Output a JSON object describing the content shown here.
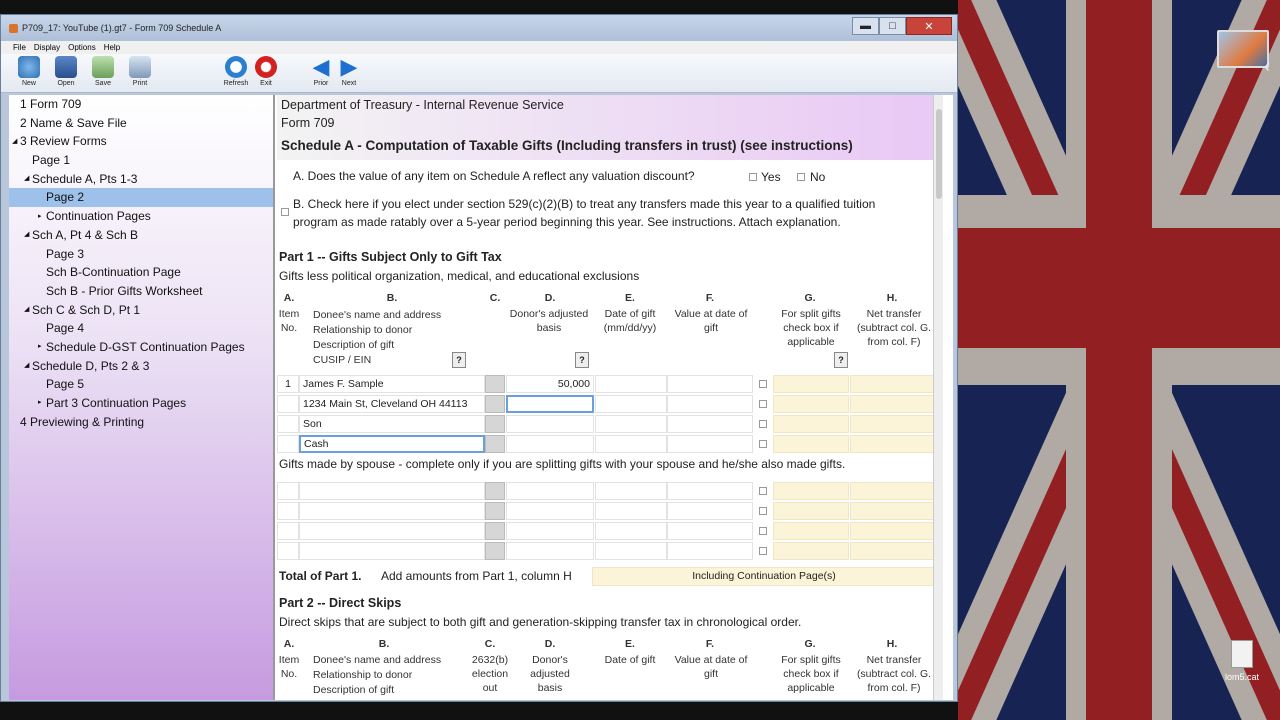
{
  "desktop": {
    "file_label": "lom5.cat"
  },
  "window": {
    "title": "P709_17: YouTube (1).gt7 - Form 709 Schedule A",
    "min": "▬",
    "max": "□",
    "close": "✕"
  },
  "menu": [
    "File",
    "Display",
    "Options",
    "Help"
  ],
  "toolbar": {
    "new": "New",
    "open": "Open",
    "save": "Save",
    "print": "Print",
    "refresh": "Refresh",
    "exit": "Exit",
    "prior": "Prior",
    "next": "Next"
  },
  "nav": [
    {
      "label": "1 Form 709",
      "level": 0,
      "arrow": ""
    },
    {
      "label": "2 Name & Save File",
      "level": 0,
      "arrow": ""
    },
    {
      "label": "3 Review Forms",
      "level": 0,
      "arrow": "◢"
    },
    {
      "label": "Page 1",
      "level": 1,
      "arrow": ""
    },
    {
      "label": "Schedule A, Pts 1-3",
      "level": 1,
      "arrow": "◢"
    },
    {
      "label": "Page 2",
      "level": 2,
      "arrow": "",
      "selected": true
    },
    {
      "label": "Continuation Pages",
      "level": 2,
      "arrow": "▸"
    },
    {
      "label": "Sch A, Pt 4 & Sch B",
      "level": 1,
      "arrow": "◢"
    },
    {
      "label": "Page 3",
      "level": 2,
      "arrow": ""
    },
    {
      "label": "Sch B-Continuation Page",
      "level": 2,
      "arrow": ""
    },
    {
      "label": "Sch B - Prior Gifts Worksheet",
      "level": 2,
      "arrow": ""
    },
    {
      "label": "Sch C & Sch D, Pt 1",
      "level": 1,
      "arrow": "◢"
    },
    {
      "label": "Page 4",
      "level": 2,
      "arrow": ""
    },
    {
      "label": "Schedule D-GST Continuation Pages",
      "level": 2,
      "arrow": "▸"
    },
    {
      "label": "Schedule D, Pts 2 & 3",
      "level": 1,
      "arrow": "◢"
    },
    {
      "label": "Page 5",
      "level": 2,
      "arrow": ""
    },
    {
      "label": "Part 3 Continuation Pages",
      "level": 2,
      "arrow": "▸"
    },
    {
      "label": "4 Previewing & Printing",
      "level": 0,
      "arrow": ""
    }
  ],
  "form": {
    "dept": "Department of Treasury - Internal Revenue Service",
    "form": "Form 709",
    "title": "Schedule A - Computation of Taxable Gifts (Including transfers in trust) (see instructions)",
    "qa": "A. Does the value of any item on Schedule A reflect any valuation discount?",
    "yes": "Yes",
    "no": "No",
    "qb1": "B. Check here if you elect under section 529(c)(2)(B) to treat any transfers made this year to a qualified tuition",
    "qb2": "program as made ratably over a 5-year period beginning this year. See instructions. Attach explanation.",
    "part1_title": "Part 1 -- Gifts Subject Only to Gift Tax",
    "part1_sub": "Gifts less political organization, medical, and educational exclusions",
    "q": "?",
    "cols": {
      "a": "A.",
      "b": "B.",
      "c": "C.",
      "d": "D.",
      "e": "E.",
      "f": "F.",
      "g": "G.",
      "h": "H.",
      "a_desc": "Item\nNo.",
      "b_desc": "Donee's name and address\nRelationship to donor\nDescription of gift\nCUSIP / EIN",
      "d_desc": "Donor's adjusted\nbasis",
      "e_desc": "Date of gift\n(mm/dd/yy)",
      "f_desc": "Value at date of\ngift",
      "g_desc": "For split gifts\ncheck box if\napplicable",
      "h_desc": "Net transfer\n(subtract col. G.\nfrom col. F)"
    },
    "row1": {
      "no": "1",
      "name": "James F. Sample",
      "addr": "1234 Main St, Cleveland OH 44113",
      "rel": "Son",
      "desc": "Cash",
      "basis": "50,000"
    },
    "spouse_note": "Gifts made by spouse - complete only if you are splitting gifts with your spouse and he/she also made gifts.",
    "total_label": "Total of Part 1.",
    "total_desc": "Add amounts from Part 1, column H",
    "total_box": "Including Continuation Page(s)",
    "part2_title": "Part 2 -- Direct Skips",
    "part2_sub": "Direct skips that are subject to both gift and generation-skipping transfer tax in chronological order.",
    "p2cols": {
      "a": "A.",
      "b": "B.",
      "c": "C.",
      "d": "D.",
      "e": "E.",
      "f": "F.",
      "g": "G.",
      "h": "H.",
      "a_desc": "Item\nNo.",
      "b_desc": "Donee's name and address\nRelationship to donor\nDescription of gift",
      "c_desc": "2632(b)\nelection\nout",
      "d_desc": "Donor's\nadjusted\nbasis",
      "e_desc": "Date of gift",
      "f_desc": "Value at date of\ngift",
      "g_desc": "For split gifts\ncheck box if\napplicable",
      "h_desc": "Net transfer\n(subtract col. G.\nfrom col. F)"
    }
  }
}
